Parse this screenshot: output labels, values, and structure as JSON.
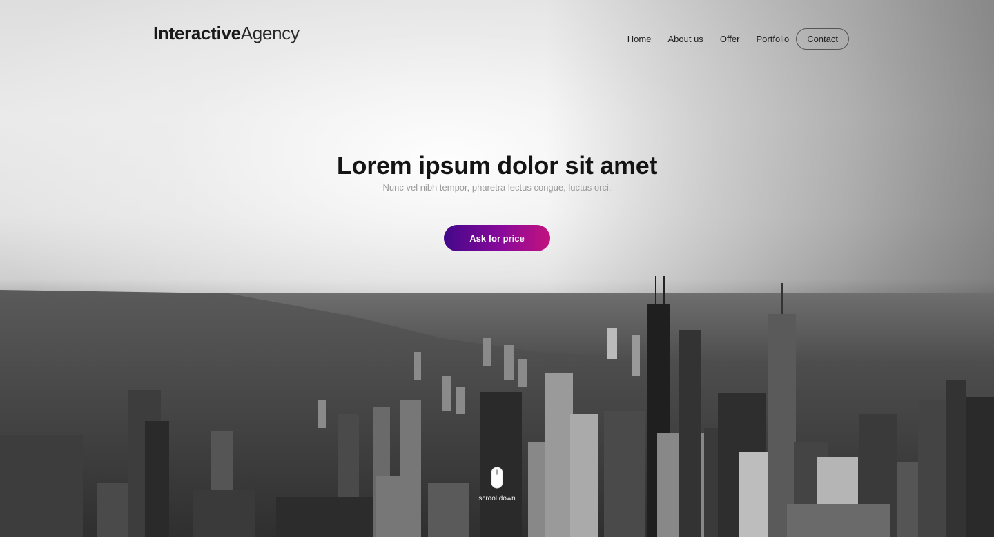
{
  "header": {
    "logo_bold": "Interactive",
    "logo_light": "Agency",
    "nav": [
      {
        "label": "Home"
      },
      {
        "label": "About us"
      },
      {
        "label": "Offer"
      },
      {
        "label": "Portfolio"
      },
      {
        "label": "Contact"
      }
    ]
  },
  "hero": {
    "title": "Lorem ipsum dolor sit amet",
    "subtitle": "Nunc vel nibh tempor, pharetra lectus congue, luctus orci.",
    "cta_label": "Ask for price",
    "scroll_label": "scrool down",
    "background_image": "aerial-city-skyline-photo"
  },
  "colors": {
    "cta_gradient_start": "#43078a",
    "cta_gradient_end": "#c2127d",
    "text_dark": "#141414",
    "subtitle": "#9a9a9a"
  }
}
